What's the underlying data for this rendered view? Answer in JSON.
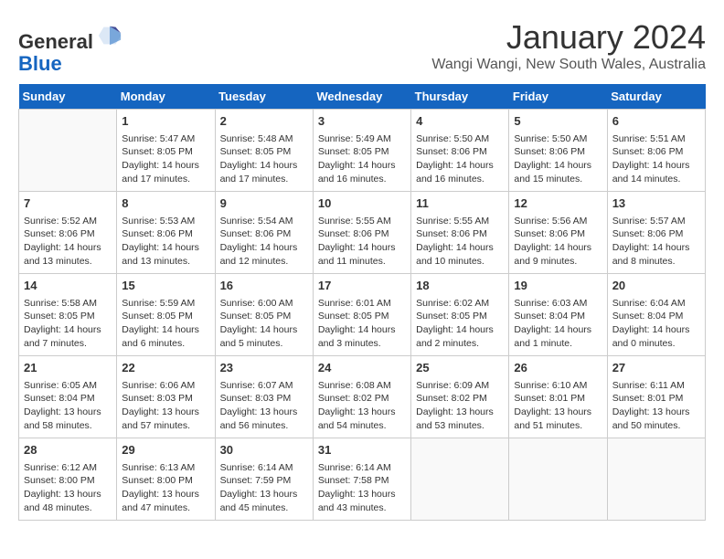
{
  "header": {
    "logo": {
      "line1": "General",
      "line2": "Blue"
    },
    "title": "January 2024",
    "location": "Wangi Wangi, New South Wales, Australia"
  },
  "weekdays": [
    "Sunday",
    "Monday",
    "Tuesday",
    "Wednesday",
    "Thursday",
    "Friday",
    "Saturday"
  ],
  "weeks": [
    [
      {
        "day": "",
        "info": ""
      },
      {
        "day": "1",
        "info": "Sunrise: 5:47 AM\nSunset: 8:05 PM\nDaylight: 14 hours\nand 17 minutes."
      },
      {
        "day": "2",
        "info": "Sunrise: 5:48 AM\nSunset: 8:05 PM\nDaylight: 14 hours\nand 17 minutes."
      },
      {
        "day": "3",
        "info": "Sunrise: 5:49 AM\nSunset: 8:05 PM\nDaylight: 14 hours\nand 16 minutes."
      },
      {
        "day": "4",
        "info": "Sunrise: 5:50 AM\nSunset: 8:06 PM\nDaylight: 14 hours\nand 16 minutes."
      },
      {
        "day": "5",
        "info": "Sunrise: 5:50 AM\nSunset: 8:06 PM\nDaylight: 14 hours\nand 15 minutes."
      },
      {
        "day": "6",
        "info": "Sunrise: 5:51 AM\nSunset: 8:06 PM\nDaylight: 14 hours\nand 14 minutes."
      }
    ],
    [
      {
        "day": "7",
        "info": "Sunrise: 5:52 AM\nSunset: 8:06 PM\nDaylight: 14 hours\nand 13 minutes."
      },
      {
        "day": "8",
        "info": "Sunrise: 5:53 AM\nSunset: 8:06 PM\nDaylight: 14 hours\nand 13 minutes."
      },
      {
        "day": "9",
        "info": "Sunrise: 5:54 AM\nSunset: 8:06 PM\nDaylight: 14 hours\nand 12 minutes."
      },
      {
        "day": "10",
        "info": "Sunrise: 5:55 AM\nSunset: 8:06 PM\nDaylight: 14 hours\nand 11 minutes."
      },
      {
        "day": "11",
        "info": "Sunrise: 5:55 AM\nSunset: 8:06 PM\nDaylight: 14 hours\nand 10 minutes."
      },
      {
        "day": "12",
        "info": "Sunrise: 5:56 AM\nSunset: 8:06 PM\nDaylight: 14 hours\nand 9 minutes."
      },
      {
        "day": "13",
        "info": "Sunrise: 5:57 AM\nSunset: 8:06 PM\nDaylight: 14 hours\nand 8 minutes."
      }
    ],
    [
      {
        "day": "14",
        "info": "Sunrise: 5:58 AM\nSunset: 8:05 PM\nDaylight: 14 hours\nand 7 minutes."
      },
      {
        "day": "15",
        "info": "Sunrise: 5:59 AM\nSunset: 8:05 PM\nDaylight: 14 hours\nand 6 minutes."
      },
      {
        "day": "16",
        "info": "Sunrise: 6:00 AM\nSunset: 8:05 PM\nDaylight: 14 hours\nand 5 minutes."
      },
      {
        "day": "17",
        "info": "Sunrise: 6:01 AM\nSunset: 8:05 PM\nDaylight: 14 hours\nand 3 minutes."
      },
      {
        "day": "18",
        "info": "Sunrise: 6:02 AM\nSunset: 8:05 PM\nDaylight: 14 hours\nand 2 minutes."
      },
      {
        "day": "19",
        "info": "Sunrise: 6:03 AM\nSunset: 8:04 PM\nDaylight: 14 hours\nand 1 minute."
      },
      {
        "day": "20",
        "info": "Sunrise: 6:04 AM\nSunset: 8:04 PM\nDaylight: 14 hours\nand 0 minutes."
      }
    ],
    [
      {
        "day": "21",
        "info": "Sunrise: 6:05 AM\nSunset: 8:04 PM\nDaylight: 13 hours\nand 58 minutes."
      },
      {
        "day": "22",
        "info": "Sunrise: 6:06 AM\nSunset: 8:03 PM\nDaylight: 13 hours\nand 57 minutes."
      },
      {
        "day": "23",
        "info": "Sunrise: 6:07 AM\nSunset: 8:03 PM\nDaylight: 13 hours\nand 56 minutes."
      },
      {
        "day": "24",
        "info": "Sunrise: 6:08 AM\nSunset: 8:02 PM\nDaylight: 13 hours\nand 54 minutes."
      },
      {
        "day": "25",
        "info": "Sunrise: 6:09 AM\nSunset: 8:02 PM\nDaylight: 13 hours\nand 53 minutes."
      },
      {
        "day": "26",
        "info": "Sunrise: 6:10 AM\nSunset: 8:01 PM\nDaylight: 13 hours\nand 51 minutes."
      },
      {
        "day": "27",
        "info": "Sunrise: 6:11 AM\nSunset: 8:01 PM\nDaylight: 13 hours\nand 50 minutes."
      }
    ],
    [
      {
        "day": "28",
        "info": "Sunrise: 6:12 AM\nSunset: 8:00 PM\nDaylight: 13 hours\nand 48 minutes."
      },
      {
        "day": "29",
        "info": "Sunrise: 6:13 AM\nSunset: 8:00 PM\nDaylight: 13 hours\nand 47 minutes."
      },
      {
        "day": "30",
        "info": "Sunrise: 6:14 AM\nSunset: 7:59 PM\nDaylight: 13 hours\nand 45 minutes."
      },
      {
        "day": "31",
        "info": "Sunrise: 6:14 AM\nSunset: 7:58 PM\nDaylight: 13 hours\nand 43 minutes."
      },
      {
        "day": "",
        "info": ""
      },
      {
        "day": "",
        "info": ""
      },
      {
        "day": "",
        "info": ""
      }
    ]
  ]
}
